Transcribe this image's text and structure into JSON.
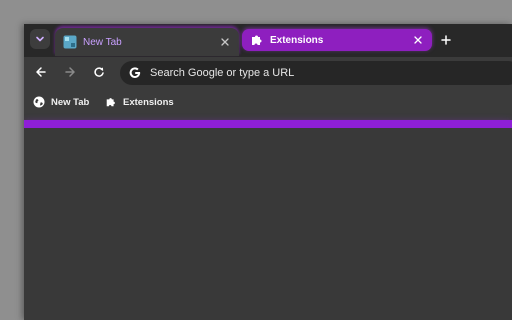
{
  "tabs": [
    {
      "title": "New Tab",
      "state": "active"
    },
    {
      "title": "Extensions",
      "state": "inactive"
    }
  ],
  "omnibox": {
    "placeholder": "Search Google or type a URL"
  },
  "bookmarks": [
    {
      "label": "New Tab",
      "icon": "globe-icon"
    },
    {
      "label": "Extensions",
      "icon": "puzzle-icon"
    }
  ],
  "colors": {
    "accent": "#8e1fd6",
    "tab_title_active": "#c9a0ff",
    "frame": "#282828",
    "toolbar": "#3b3b3b",
    "omnibox": "#262626"
  }
}
